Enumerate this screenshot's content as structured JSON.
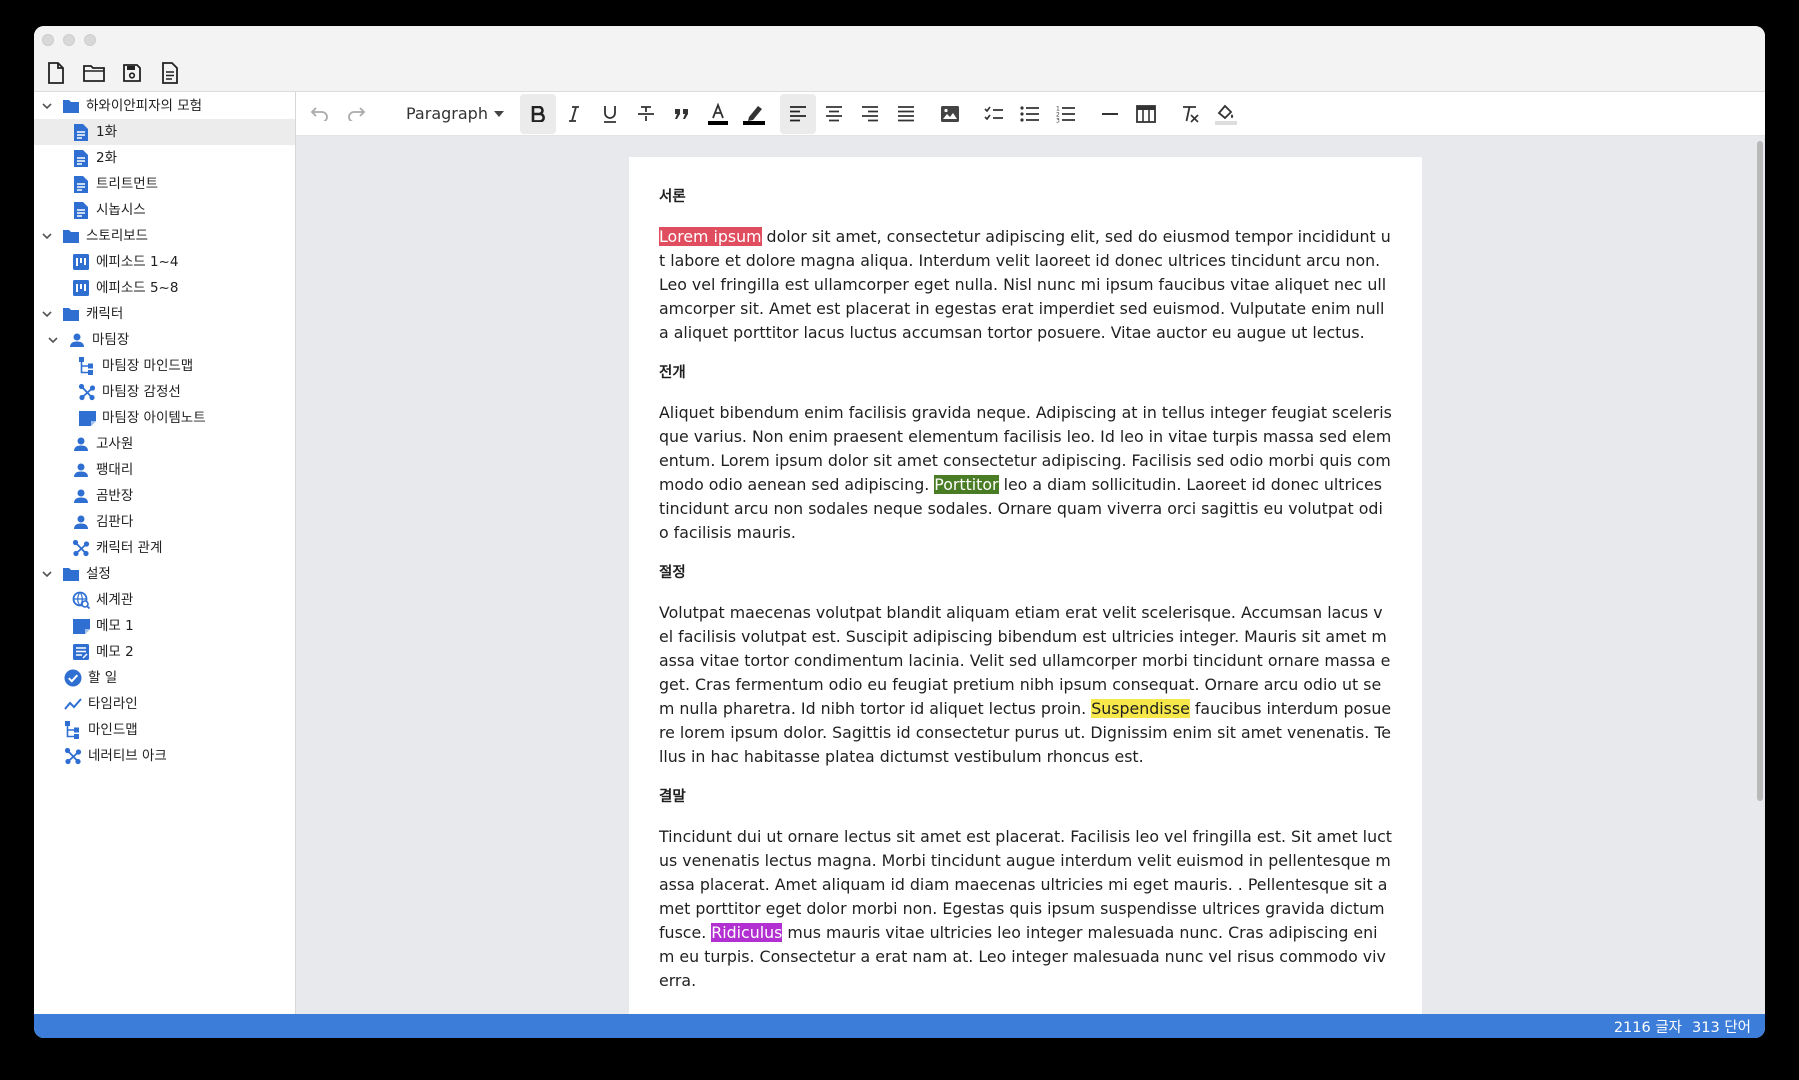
{
  "colors": {
    "accent": "#3b7dd8",
    "icon_blue": "#2f6fd2",
    "status_bar": "#3b7dd8"
  },
  "filebar": {
    "icons": [
      "new-file-icon",
      "open-folder-icon",
      "save-icon",
      "document-icon"
    ]
  },
  "sidebar": {
    "items": [
      {
        "label": "하와이안피자의 모험",
        "icon": "folder-icon",
        "chevron": true
      },
      {
        "label": "1화",
        "icon": "document-icon",
        "selected": true
      },
      {
        "label": "2화",
        "icon": "document-icon"
      },
      {
        "label": "트리트먼트",
        "icon": "document-icon"
      },
      {
        "label": "시놉시스",
        "icon": "document-icon"
      },
      {
        "label": "스토리보드",
        "icon": "folder-icon",
        "chevron": true
      },
      {
        "label": "에피소드 1~4",
        "icon": "kanban-icon"
      },
      {
        "label": "에피소드 5~8",
        "icon": "kanban-icon"
      },
      {
        "label": "캐릭터",
        "icon": "folder-icon",
        "chevron": true
      },
      {
        "label": "마팀장",
        "icon": "person-icon",
        "chevron": true
      },
      {
        "label": "마팀장 마인드맵",
        "icon": "mindmap-icon"
      },
      {
        "label": "마팀장 감정선",
        "icon": "arc-icon"
      },
      {
        "label": "마팀장 아이템노트",
        "icon": "note-icon"
      },
      {
        "label": "고사원",
        "icon": "person-icon"
      },
      {
        "label": "팽대리",
        "icon": "person-icon"
      },
      {
        "label": "곰반장",
        "icon": "person-icon"
      },
      {
        "label": "김판다",
        "icon": "person-icon"
      },
      {
        "label": "캐릭터 관계",
        "icon": "arc-icon"
      },
      {
        "label": "설정",
        "icon": "folder-icon",
        "chevron": true
      },
      {
        "label": "세계관",
        "icon": "world-icon"
      },
      {
        "label": "메모 1",
        "icon": "note-icon"
      },
      {
        "label": "메모 2",
        "icon": "memo-icon"
      },
      {
        "label": "할 일",
        "icon": "check-circle-icon"
      },
      {
        "label": "타임라인",
        "icon": "timeline-icon"
      },
      {
        "label": "마인드맵",
        "icon": "mindmap-icon"
      },
      {
        "label": "네러티브 아크",
        "icon": "arc-icon"
      }
    ]
  },
  "toolbar": {
    "paragraph_label": "Paragraph",
    "buttons": [
      "undo-icon",
      "redo-icon",
      "bold-icon",
      "italic-icon",
      "underline-icon",
      "strikethrough-icon",
      "quote-icon",
      "text-color-icon",
      "highlight-icon",
      "align-left-icon",
      "align-center-icon",
      "align-right-icon",
      "align-justify-icon",
      "image-icon",
      "checklist-icon",
      "bullet-list-icon",
      "numbered-list-icon",
      "horizontal-rule-icon",
      "table-icon",
      "clear-format-icon",
      "fill-color-icon"
    ]
  },
  "document": {
    "sections": [
      {
        "heading": "서론",
        "parts": [
          {
            "text": "Lorem ipsum",
            "highlight": "red"
          },
          {
            "text": " dolor sit amet, consectetur adipiscing elit, sed do eiusmod tempor incididunt ut labore et dolore magna aliqua. Interdum velit laoreet id donec ultrices tincidunt arcu non. Leo vel fringilla est ullamcorper eget nulla. Nisl nunc mi ipsum faucibus vitae aliquet nec ullamcorper sit. Amet est placerat in egestas erat imperdiet sed euismod. Vulputate enim nulla aliquet porttitor lacus luctus accumsan tortor posuere. Vitae auctor eu augue ut lectus."
          }
        ]
      },
      {
        "heading": "전개",
        "parts": [
          {
            "text": "Aliquet bibendum enim facilisis gravida neque. Adipiscing at in tellus integer feugiat scelerisque varius. Non enim praesent elementum facilisis leo. Id leo in vitae turpis massa sed elementum. Lorem ipsum dolor sit amet consectetur adipiscing. Facilisis sed odio morbi quis commodo odio aenean sed adipiscing. "
          },
          {
            "text": "Porttitor",
            "highlight": "green"
          },
          {
            "text": " leo a diam sollicitudin. Laoreet id donec ultrices tincidunt arcu non sodales neque sodales. Ornare quam viverra orci sagittis eu volutpat odio facilisis mauris."
          }
        ]
      },
      {
        "heading": "절정",
        "parts": [
          {
            "text": "Volutpat maecenas volutpat blandit aliquam etiam erat velit scelerisque. Accumsan lacus vel facilisis volutpat est. Suscipit adipiscing bibendum est ultricies integer. Mauris sit amet massa vitae tortor condimentum lacinia. Velit sed ullamcorper morbi tincidunt ornare massa eget. Cras fermentum odio eu feugiat pretium nibh ipsum consequat. Ornare arcu odio ut sem nulla pharetra. Id nibh tortor id aliquet lectus proin. "
          },
          {
            "text": "Suspendisse",
            "highlight": "yellow"
          },
          {
            "text": " faucibus interdum posuere lorem ipsum dolor. Sagittis id consectetur purus ut. Dignissim enim sit amet venenatis. Tellus in hac habitasse platea dictumst vestibulum rhoncus est."
          }
        ]
      },
      {
        "heading": "결말",
        "parts": [
          {
            "text": "Tincidunt dui ut ornare lectus sit amet est placerat. Facilisis leo vel fringilla est. Sit amet luctus venenatis lectus magna. Morbi tincidunt augue interdum velit euismod in pellentesque massa placerat. Amet aliquam id diam maecenas ultricies mi eget mauris. . Pellentesque sit amet porttitor eget dolor morbi non. Egestas quis ipsum suspendisse ultrices gravida dictum fusce. "
          },
          {
            "text": "Ridiculus",
            "highlight": "purple"
          },
          {
            "text": " mus mauris vitae ultricies leo integer malesuada nunc. Cras adipiscing enim eu turpis. Consectetur a erat nam at. Leo integer malesuada nunc vel risus commodo viverra."
          }
        ]
      }
    ]
  },
  "status": {
    "char_count": "2116 글자",
    "word_count": "313 단어"
  }
}
